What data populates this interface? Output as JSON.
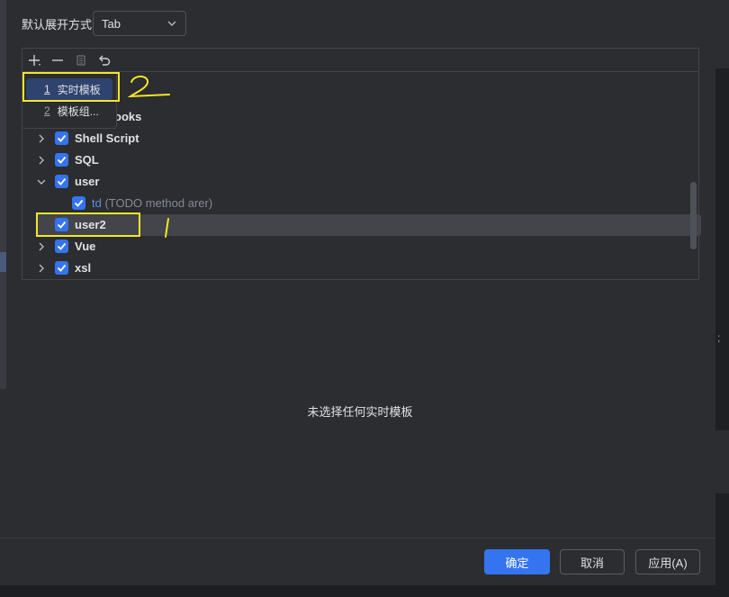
{
  "expand": {
    "label": "默认展开方式",
    "value": "Tab"
  },
  "toolbar": {
    "add_icon": "plus-icon",
    "remove_icon": "minus-icon",
    "copy_icon": "copy-icon",
    "restore_icon": "undo-icon"
  },
  "popup": {
    "items": [
      {
        "num": "1",
        "label": "实时模板"
      },
      {
        "num": "2",
        "label": "模板组..."
      }
    ]
  },
  "tree": {
    "partial_label": "ooks",
    "groups": [
      {
        "label": "Shell Script",
        "checked": true,
        "expanded": false
      },
      {
        "label": "SQL",
        "checked": true,
        "expanded": false
      },
      {
        "label": "user",
        "checked": true,
        "expanded": true
      },
      {
        "label": "user2",
        "checked": true,
        "expanded": false,
        "selected": true
      },
      {
        "label": "Vue",
        "checked": true,
        "expanded": false
      },
      {
        "label": "xsl",
        "checked": true,
        "expanded": false
      }
    ],
    "child": {
      "abbr": "td",
      "desc": "(TODO method arer)"
    }
  },
  "empty_message": "未选择任何实时模板",
  "buttons": {
    "ok": "确定",
    "cancel": "取消",
    "apply": "应用(A)"
  },
  "right_edge_text": ";",
  "colors": {
    "accent": "#3574f0",
    "annotation": "#f5e62a",
    "background": "#2b2d30"
  }
}
